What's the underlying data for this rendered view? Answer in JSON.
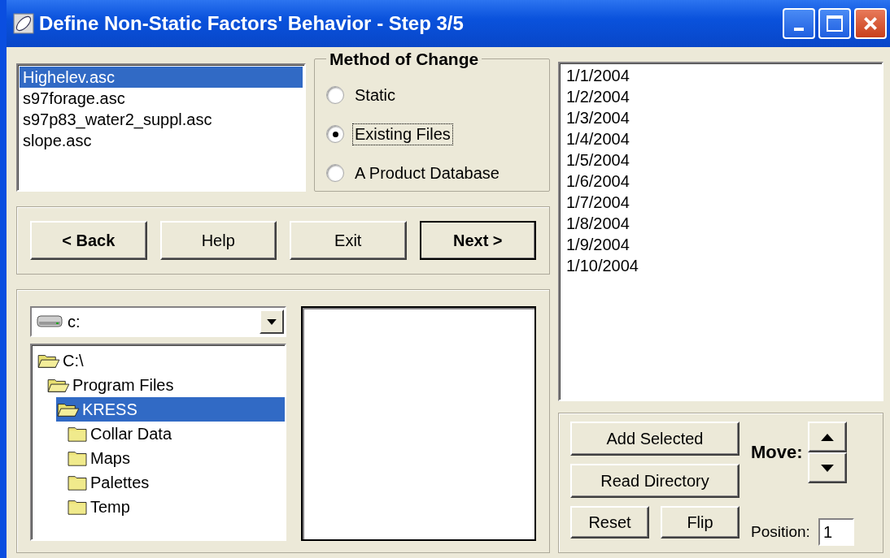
{
  "window": {
    "title": "Define Non-Static Factors' Behavior - Step 3/5"
  },
  "factor_list": [
    {
      "label": "Highelev.asc",
      "selected": true
    },
    {
      "label": "s97forage.asc",
      "selected": false
    },
    {
      "label": "s97p83_water2_suppl.asc",
      "selected": false
    },
    {
      "label": "slope.asc",
      "selected": false
    }
  ],
  "method_of_change": {
    "title": "Method of Change",
    "options": [
      {
        "label": "Static",
        "selected": false
      },
      {
        "label": "Existing Files",
        "selected": true
      },
      {
        "label": "A Product Database",
        "selected": false
      }
    ]
  },
  "nav_buttons": [
    {
      "label": "< Back",
      "default": false,
      "bold": true
    },
    {
      "label": "Help",
      "default": false,
      "bold": false
    },
    {
      "label": "Exit",
      "default": false,
      "bold": false
    },
    {
      "label": "Next >",
      "default": true,
      "bold": true
    }
  ],
  "drive_select": {
    "value": "c:"
  },
  "folder_tree": [
    {
      "label": "C:\\",
      "expanded": true,
      "selected": false,
      "children": [
        {
          "label": "Program Files",
          "expanded": true,
          "selected": false,
          "children": [
            {
              "label": "KRESS",
              "expanded": true,
              "selected": true,
              "children": [
                {
                  "label": "Collar Data",
                  "expanded": false,
                  "selected": false
                },
                {
                  "label": "Maps",
                  "expanded": false,
                  "selected": false
                },
                {
                  "label": "Palettes",
                  "expanded": false,
                  "selected": false
                },
                {
                  "label": "Temp",
                  "expanded": false,
                  "selected": false
                }
              ]
            }
          ]
        }
      ]
    }
  ],
  "dates": [
    "1/1/2004",
    "1/2/2004",
    "1/3/2004",
    "1/4/2004",
    "1/5/2004",
    "1/6/2004",
    "1/7/2004",
    "1/8/2004",
    "1/9/2004",
    "1/10/2004"
  ],
  "actions": {
    "add_selected": "Add Selected",
    "read_directory": "Read Directory",
    "reset": "Reset",
    "flip": "Flip",
    "move_label": "Move:",
    "position_label": "Position:",
    "position_value": "1"
  }
}
